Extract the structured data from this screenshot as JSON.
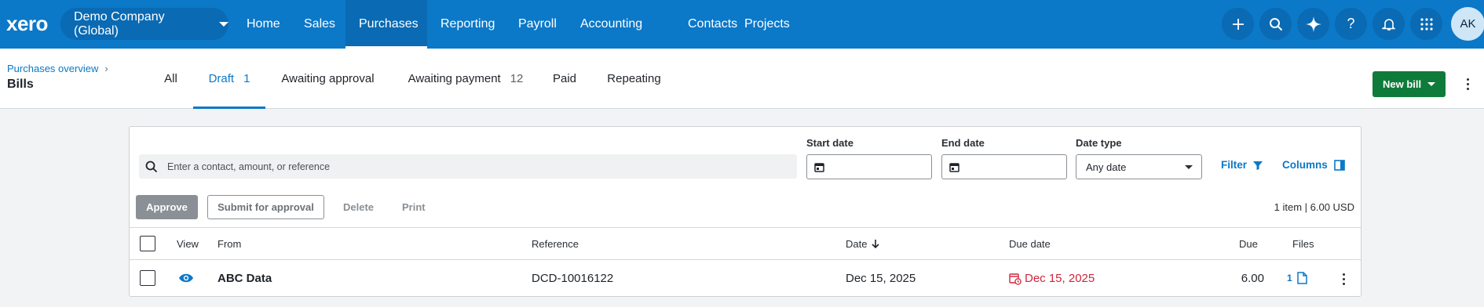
{
  "app": {
    "logo": "xero"
  },
  "org": {
    "name": "Demo Company (Global)"
  },
  "nav": {
    "items": [
      {
        "label": "Home"
      },
      {
        "label": "Sales"
      },
      {
        "label": "Purchases"
      },
      {
        "label": "Reporting"
      },
      {
        "label": "Payroll"
      },
      {
        "label": "Accounting"
      },
      {
        "label": "Contacts"
      },
      {
        "label": "Projects"
      }
    ],
    "active": "Purchases"
  },
  "toolbar": {
    "icons": [
      "plus-icon",
      "search-icon",
      "sparkle-icon",
      "help-icon",
      "bell-icon",
      "apps-grid-icon"
    ],
    "avatar_initials": "AK"
  },
  "header": {
    "breadcrumb": "Purchases overview",
    "title": "Bills",
    "new_bill_label": "New bill"
  },
  "tabs": [
    {
      "label": "All",
      "count": ""
    },
    {
      "label": "Draft",
      "count": "1"
    },
    {
      "label": "Awaiting approval",
      "count": ""
    },
    {
      "label": "Awaiting payment",
      "count": "12"
    },
    {
      "label": "Paid",
      "count": ""
    },
    {
      "label": "Repeating",
      "count": ""
    }
  ],
  "filters": {
    "search_placeholder": "Enter a contact, amount, or reference",
    "start_date_label": "Start date",
    "end_date_label": "End date",
    "date_type_label": "Date type",
    "date_type_value": "Any date",
    "filter_label": "Filter",
    "columns_label": "Columns"
  },
  "actions": {
    "approve": "Approve",
    "submit": "Submit for approval",
    "delete": "Delete",
    "print": "Print",
    "summary": "1 item | 6.00 USD"
  },
  "table": {
    "headers": {
      "view": "View",
      "from": "From",
      "reference": "Reference",
      "date": "Date",
      "due_date": "Due date",
      "due": "Due",
      "files": "Files"
    },
    "rows": [
      {
        "from": "ABC Data",
        "reference": "DCD-10016122",
        "date": "Dec 15, 2025",
        "due_date": "Dec 15, 2025",
        "due": "6.00",
        "files": "1"
      }
    ]
  },
  "colors": {
    "brand_blue": "#0b78c8",
    "new_bill_green": "#0f7b3a",
    "overdue_red": "#d1243c"
  }
}
